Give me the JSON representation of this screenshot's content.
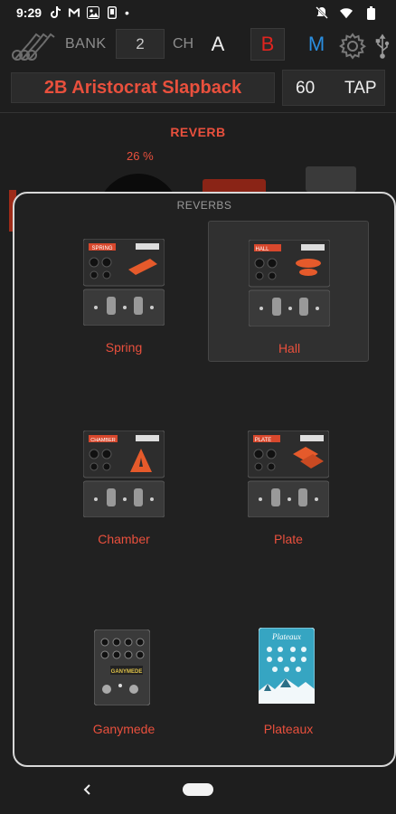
{
  "status_bar": {
    "time": "9:29"
  },
  "header": {
    "bank_label": "BANK",
    "bank_number": "2",
    "channel_label": "CH",
    "channels": [
      "A",
      "B",
      "M"
    ],
    "selected_channel": "B",
    "colors": {
      "channel_a": "#eeeeee",
      "channel_b": "#e0241f",
      "channel_m": "#2a8ee0"
    }
  },
  "preset": {
    "name": "2B Aristocrat Slapback",
    "tempo": "60",
    "tap_label": "TAP"
  },
  "effect_editor": {
    "title": "REVERB",
    "value_readout": "26 %"
  },
  "reverb_picker": {
    "title": "REVERBS",
    "selected": "Hall",
    "items": [
      {
        "label": "Spring",
        "screen_label": "SPRING"
      },
      {
        "label": "Hall",
        "screen_label": "HALL"
      },
      {
        "label": "Chamber",
        "screen_label": "CHAMBER"
      },
      {
        "label": "Plate",
        "screen_label": "PLATE"
      },
      {
        "label": "Ganymede",
        "screen_label": "GANYMEDE"
      },
      {
        "label": "Plateaux",
        "screen_label": "Plateaux"
      }
    ]
  },
  "colors": {
    "accent": "#e9503d",
    "background": "#1e1e1e",
    "modal_border": "#d8d8d8"
  }
}
